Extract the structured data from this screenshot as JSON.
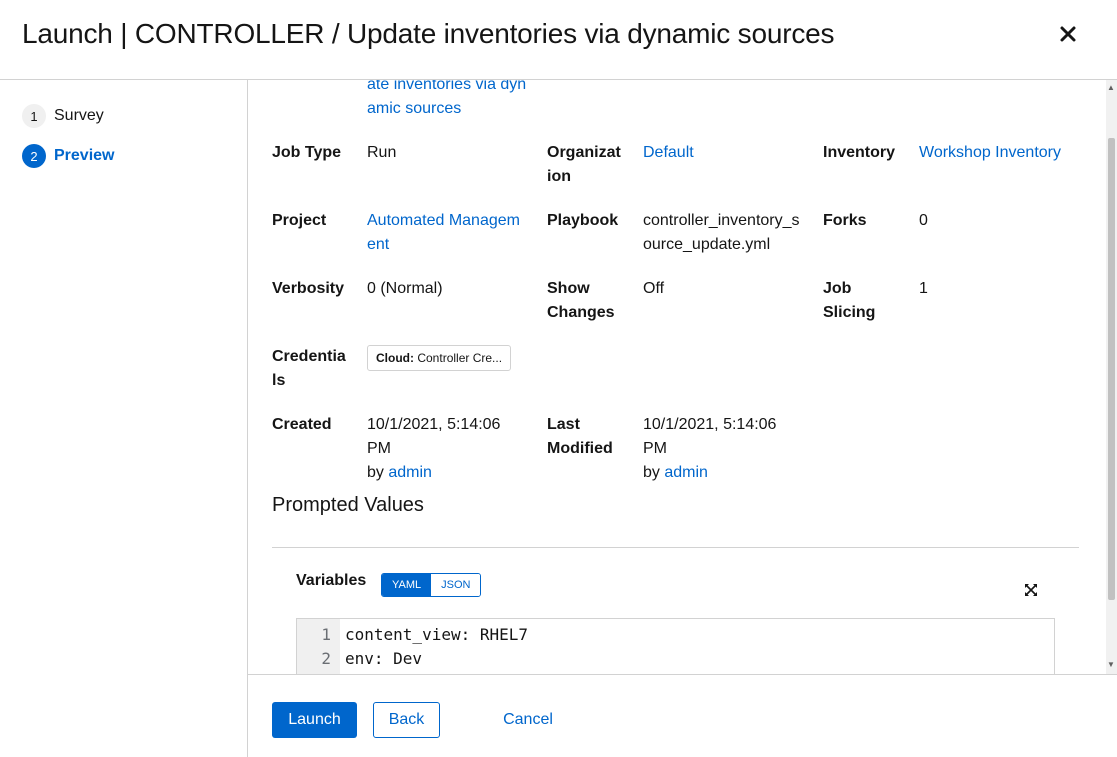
{
  "header": {
    "title": "Launch | CONTROLLER / Update inventories via dynamic sources"
  },
  "nav": {
    "steps": [
      {
        "number": "1",
        "label": "Survey"
      },
      {
        "number": "2",
        "label": "Preview"
      }
    ]
  },
  "details": {
    "name_value_line1": "ate inventories via dyn",
    "name_value_line2": "amic sources",
    "job_type": {
      "label": "Job Type",
      "value": "Run"
    },
    "organization": {
      "label_line1": "Organizat",
      "label_line2": "ion",
      "value": "Default"
    },
    "inventory": {
      "label": "Inventory",
      "value": "Workshop Inventory"
    },
    "project": {
      "label": "Project",
      "value_line1": "Automated Managem",
      "value_line2": "ent"
    },
    "playbook": {
      "label": "Playbook",
      "value_line1": "controller_inventory_s",
      "value_line2": "ource_update.yml"
    },
    "forks": {
      "label": "Forks",
      "value": "0"
    },
    "verbosity": {
      "label": "Verbosity",
      "value": "0 (Normal)"
    },
    "show_changes": {
      "label_line1": "Show",
      "label_line2": "Changes",
      "value": "Off"
    },
    "job_slicing": {
      "label_line1": "Job",
      "label_line2": "Slicing",
      "value": "1"
    },
    "credentials": {
      "label_line1": "Credentia",
      "label_line2": "ls",
      "chip_type": "Cloud:",
      "chip_value": "Controller Cre..."
    },
    "created": {
      "label": "Created",
      "date": "10/1/2021, 5:14:06 PM",
      "by": "by",
      "user": "admin"
    },
    "last_modified": {
      "label_line1": "Last",
      "label_line2": "Modified",
      "date": "10/1/2021, 5:14:06 PM",
      "by": "by",
      "user": "admin"
    }
  },
  "prompted": {
    "title": "Prompted Values",
    "variables_label": "Variables",
    "toggle_yaml": "YAML",
    "toggle_json": "JSON",
    "selected_mode": "YAML",
    "code_lines": [
      {
        "num": "1",
        "text": "content_view: RHEL7"
      },
      {
        "num": "2",
        "text": "env: Dev"
      }
    ]
  },
  "footer": {
    "launch": "Launch",
    "back": "Back",
    "cancel": "Cancel"
  },
  "colors": {
    "primary": "#0066cc",
    "border": "#d2d2d2",
    "text": "#151515"
  },
  "icons": {
    "close": "close-icon",
    "expand": "expand-icon"
  }
}
